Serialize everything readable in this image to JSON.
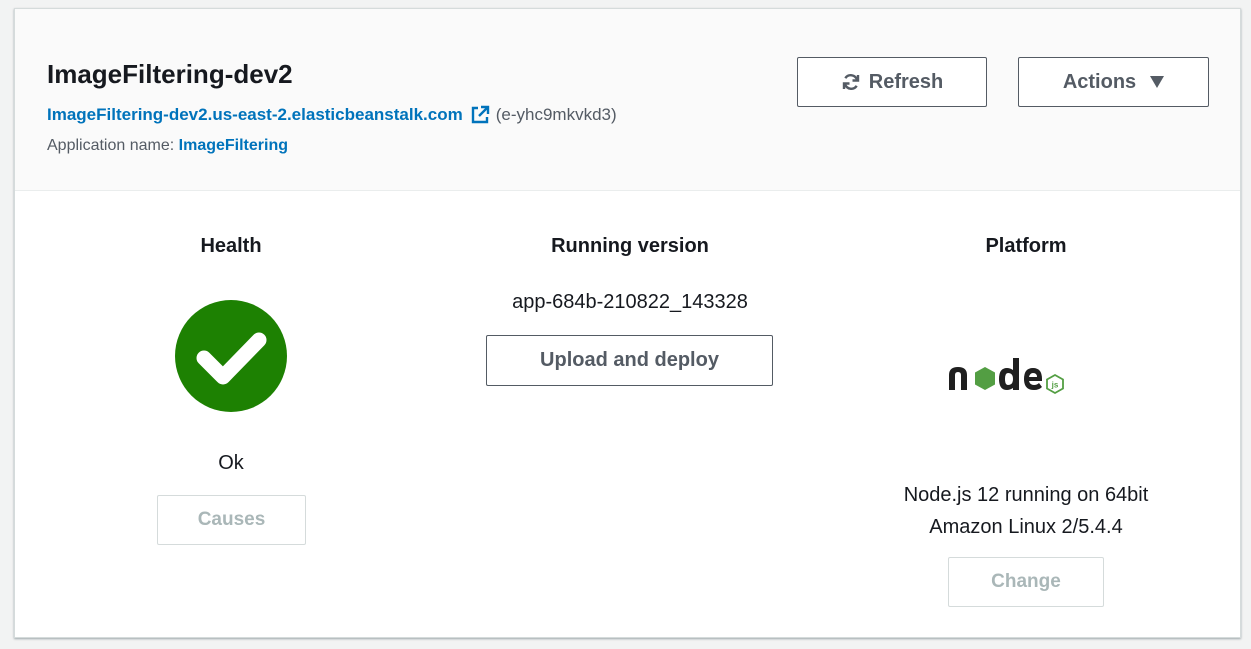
{
  "environment": {
    "name": "ImageFiltering-dev2",
    "url": "ImageFiltering-dev2.us-east-2.elasticbeanstalk.com",
    "id": "(e-yhc9mkvkd3)",
    "application_label": "Application name:",
    "application_name": "ImageFiltering"
  },
  "header": {
    "refresh_label": "Refresh",
    "actions_label": "Actions"
  },
  "health": {
    "title": "Health",
    "status": "Ok",
    "status_color": "#1d8102",
    "causes_label": "Causes"
  },
  "version": {
    "title": "Running version",
    "label": "app-684b-210822_143328",
    "upload_label": "Upload and deploy"
  },
  "platform": {
    "title": "Platform",
    "logo_icon": "nodejs-logo-icon",
    "description_line1": "Node.js 12 running on 64bit",
    "description_line2": "Amazon Linux 2/5.4.4",
    "change_label": "Change"
  },
  "colors": {
    "link": "#0073bb",
    "nodejs_green": "#539e43"
  }
}
